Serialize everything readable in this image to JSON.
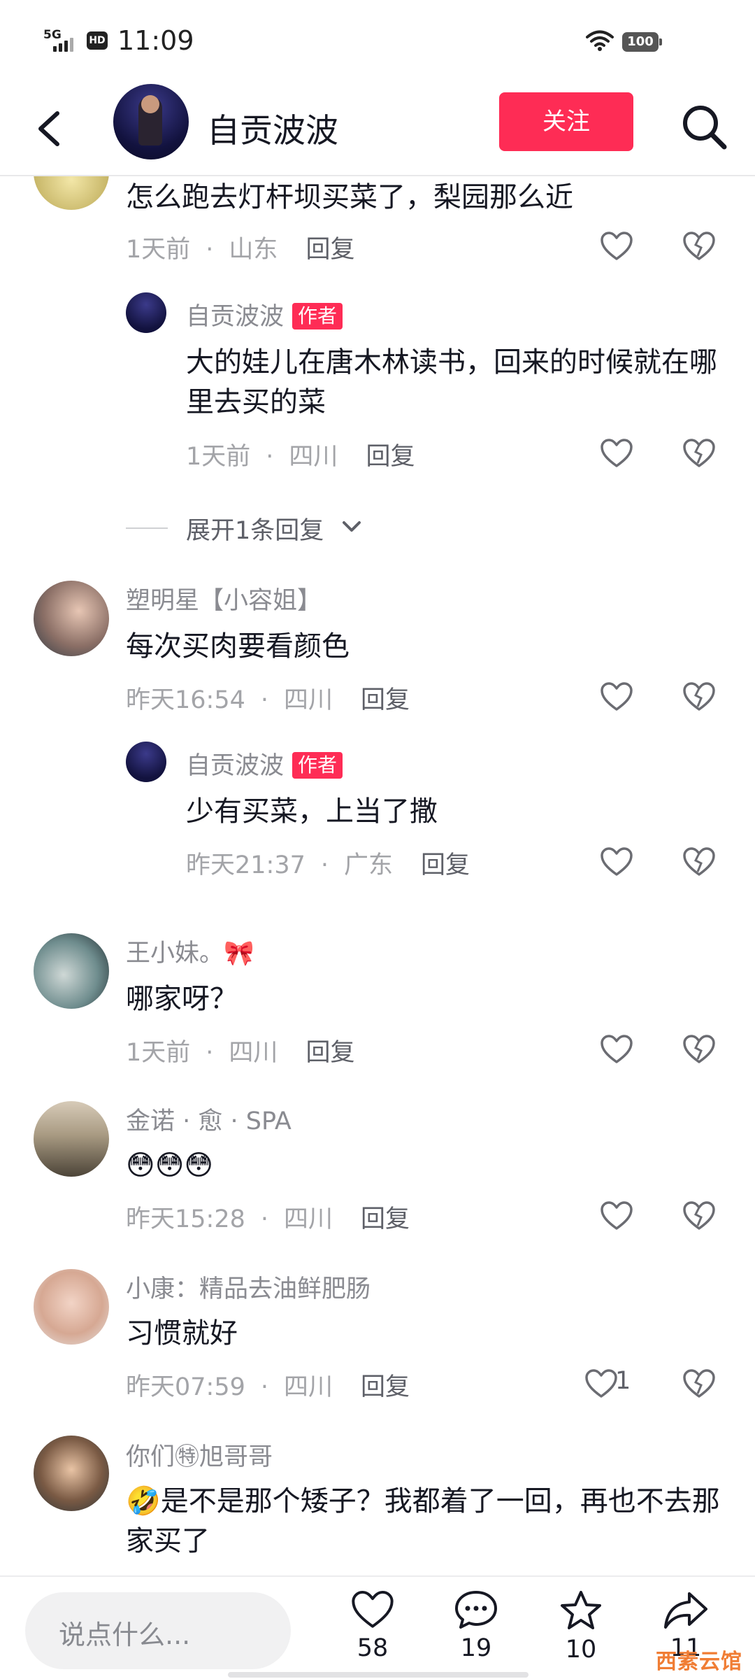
{
  "status_bar": {
    "network": "5G",
    "hd": "HD",
    "time": "11:09",
    "battery": "100"
  },
  "header": {
    "title": "自贡波波",
    "follow_label": "关注"
  },
  "comments": [
    {
      "text": "怎么跑去灯杆坝买菜了，梨园那么近",
      "time": "1天前",
      "location": "山东",
      "reply_label": "回复"
    },
    {
      "nickname": "自贡波波",
      "author_tag": "作者",
      "text": "大的娃儿在唐木林读书，回来的时候就在哪里去买的菜",
      "time": "1天前",
      "location": "四川",
      "reply_label": "回复"
    },
    {
      "nickname": "塑明星【小容姐】",
      "text": "每次买肉要看颜色",
      "time": "昨天16:54",
      "location": "四川",
      "reply_label": "回复"
    },
    {
      "nickname": "自贡波波",
      "author_tag": "作者",
      "text": "少有买菜，上当了撒",
      "time": "昨天21:37",
      "location": "广东",
      "reply_label": "回复"
    },
    {
      "nickname": "王小妹。🎀",
      "text": "哪家呀？",
      "time": "1天前",
      "location": "四川",
      "reply_label": "回复"
    },
    {
      "nickname": "金诺 · 愈 · SPA",
      "text": "😳😳😳",
      "time": "昨天15:28",
      "location": "四川",
      "reply_label": "回复"
    },
    {
      "nickname": "小康：精品去油鲜肥肠",
      "text": "习惯就好",
      "time": "昨天07:59",
      "location": "四川",
      "reply_label": "回复",
      "likes": "1"
    },
    {
      "nickname": "你们㊕旭哥哥",
      "text": "🤣是不是那个矮子？我都着了一回，再也不去那家买了"
    }
  ],
  "expand_replies": "展开1条回复",
  "bottom_bar": {
    "input_placeholder": "说点什么...",
    "likes": "58",
    "comments": "19",
    "favorites": "10",
    "shares": "11"
  },
  "watermark": "西素云馆",
  "colors": {
    "accent": "#fe2c55",
    "meta": "#a3a4a8",
    "nickname": "#8a8b91"
  },
  "icons": [
    "back-icon",
    "search-icon",
    "heart-icon",
    "broken-heart-icon",
    "chevron-down-icon",
    "comment-icon",
    "star-icon",
    "share-icon",
    "wifi-icon",
    "signal-icon"
  ]
}
